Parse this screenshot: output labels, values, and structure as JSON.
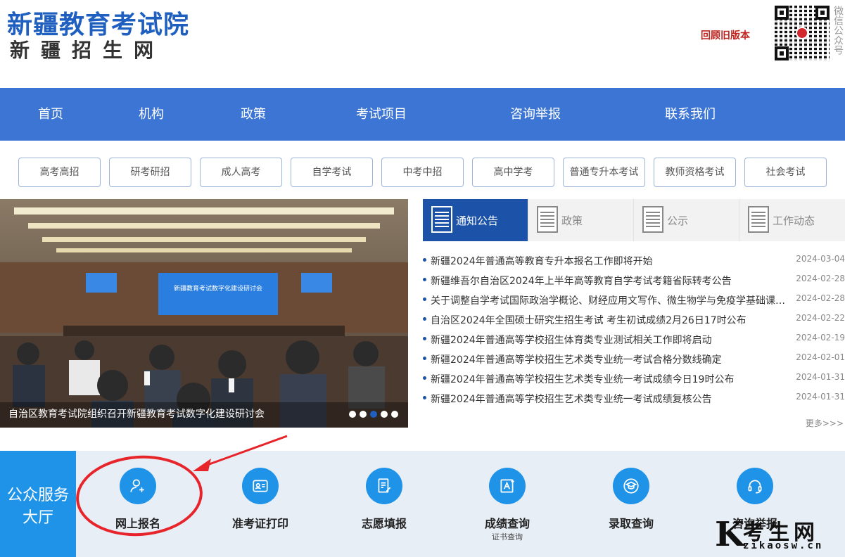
{
  "header": {
    "site_title": "新疆教育考试院",
    "site_subtitle": "新疆招生网",
    "old_version_link": "回顾旧版本",
    "wechat_label": "微信公众号"
  },
  "nav": {
    "items": [
      {
        "label": "首页"
      },
      {
        "label": "机构"
      },
      {
        "label": "政策"
      },
      {
        "label": "考试项目"
      },
      {
        "label": "咨询举报"
      },
      {
        "label": "联系我们"
      }
    ]
  },
  "categories": [
    {
      "label": "高考高招"
    },
    {
      "label": "研考研招"
    },
    {
      "label": "成人高考"
    },
    {
      "label": "自学考试"
    },
    {
      "label": "中考中招"
    },
    {
      "label": "高中学考"
    },
    {
      "label": "普通专升本考试"
    },
    {
      "label": "教师资格考试"
    },
    {
      "label": "社会考试"
    }
  ],
  "slider": {
    "caption": "自治区教育考试院组织召开新疆教育考试数字化建设研讨会",
    "banner_text": "新疆教育考试数字化建设研讨会",
    "dot_count": 5,
    "active_dot": 3
  },
  "news": {
    "tabs": [
      {
        "label": "通知公告",
        "active": true
      },
      {
        "label": "政策",
        "active": false
      },
      {
        "label": "公示",
        "active": false
      },
      {
        "label": "工作动态",
        "active": false
      }
    ],
    "items": [
      {
        "title": "新疆2024年普通高等教育专升本报名工作即将开始",
        "date": "2024-03-04"
      },
      {
        "title": "新疆维吾尔自治区2024年上半年高等教育自学考试考籍省际转考公告",
        "date": "2024-02-28"
      },
      {
        "title": "关于调整自学考试国际政治学概论、财经应用文写作、微生物学与免疫学基础课程考试时间的公告",
        "date": "2024-02-28"
      },
      {
        "title": "自治区2024年全国硕士研究生招生考试 考生初试成绩2月26日17时公布",
        "date": "2024-02-22"
      },
      {
        "title": "新疆2024年普通高等学校招生体育类专业测试相关工作即将启动",
        "date": "2024-02-19"
      },
      {
        "title": "新疆2024年普通高等学校招生艺术类专业统一考试合格分数线确定",
        "date": "2024-02-01"
      },
      {
        "title": "新疆2024年普通高等学校招生艺术类专业统一考试成绩今日19时公布",
        "date": "2024-01-31"
      },
      {
        "title": "新疆2024年普通高等学校招生艺术类专业统一考试成绩复核公告",
        "date": "2024-01-31"
      }
    ],
    "more_link": "更多>>>"
  },
  "service": {
    "hall_label": "公众服务大厅",
    "items": [
      {
        "label": "网上报名",
        "icon": "user-add-icon",
        "sub": ""
      },
      {
        "label": "准考证打印",
        "icon": "id-card-icon",
        "sub": ""
      },
      {
        "label": "志愿填报",
        "icon": "edit-form-icon",
        "sub": ""
      },
      {
        "label": "成绩查询",
        "icon": "score-icon",
        "sub": "证书查询"
      },
      {
        "label": "录取查询",
        "icon": "graduation-cap-icon",
        "sub": ""
      },
      {
        "label": "咨询举报",
        "icon": "headset-icon",
        "sub": ""
      }
    ]
  },
  "watermark": {
    "letter": "K",
    "main": "考生网",
    "sub": "zikaosw.cn"
  },
  "colors": {
    "brand_blue": "#3c75d3",
    "tab_active": "#1c53a8",
    "service_blue": "#1f93e8",
    "annotation_red": "#e8242b",
    "old_version_red": "#c0231d"
  }
}
